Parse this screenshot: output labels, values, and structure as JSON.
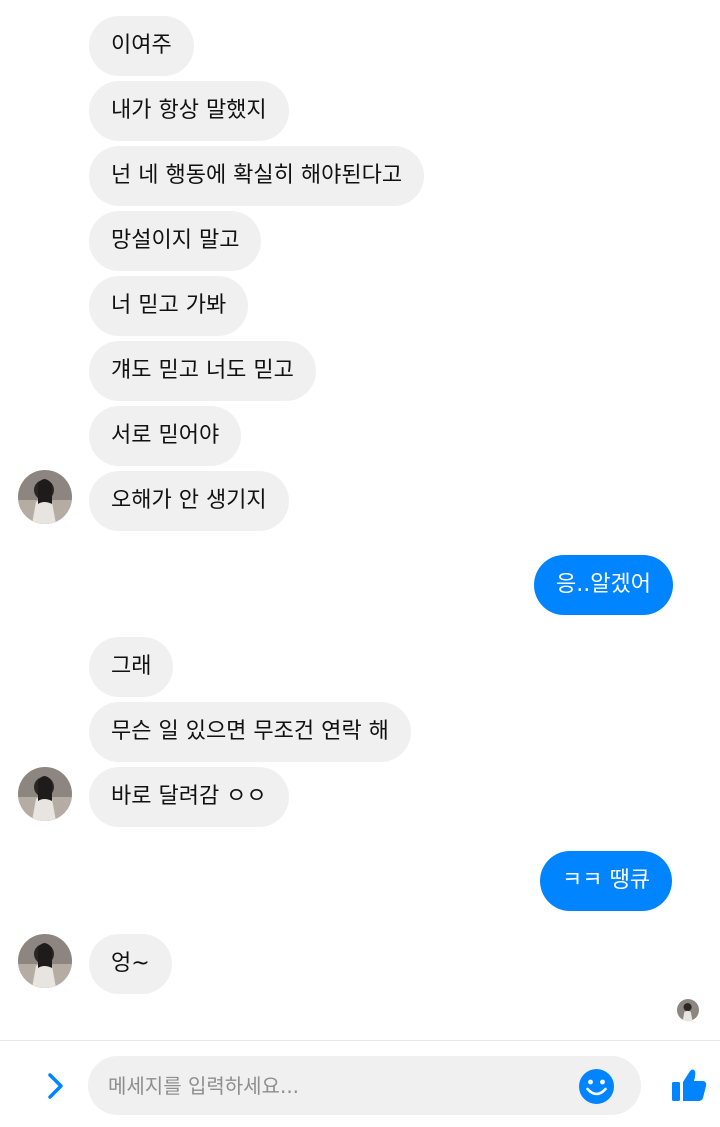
{
  "messages": [
    {
      "text": "이여주"
    },
    {
      "text": "내가 항상 말했지"
    },
    {
      "text": "넌 네 행동에 확실히 해야된다고"
    },
    {
      "text": "망설이지 말고"
    },
    {
      "text": "너 믿고 가봐"
    },
    {
      "text": "걔도 믿고 너도 믿고"
    },
    {
      "text": "서로 믿어야"
    },
    {
      "text": "오해가 안 생기지"
    },
    {
      "text": "응..알겠어"
    },
    {
      "text": "그래"
    },
    {
      "text": "무슨 일 있으면 무조건 연락 해"
    },
    {
      "text": "바로 달려감 ㅇㅇ"
    },
    {
      "text": "ㅋㅋ 땡큐"
    },
    {
      "text": "엉~"
    }
  ],
  "composer": {
    "placeholder": "메세지를 입력하세요...",
    "icons": [
      "chevron-right-icon",
      "smiley-icon",
      "thumbs-up-icon"
    ]
  },
  "colors": {
    "accent": "#0084ff",
    "incoming_bubble": "#f0f0f0",
    "background": "#ffffff"
  }
}
